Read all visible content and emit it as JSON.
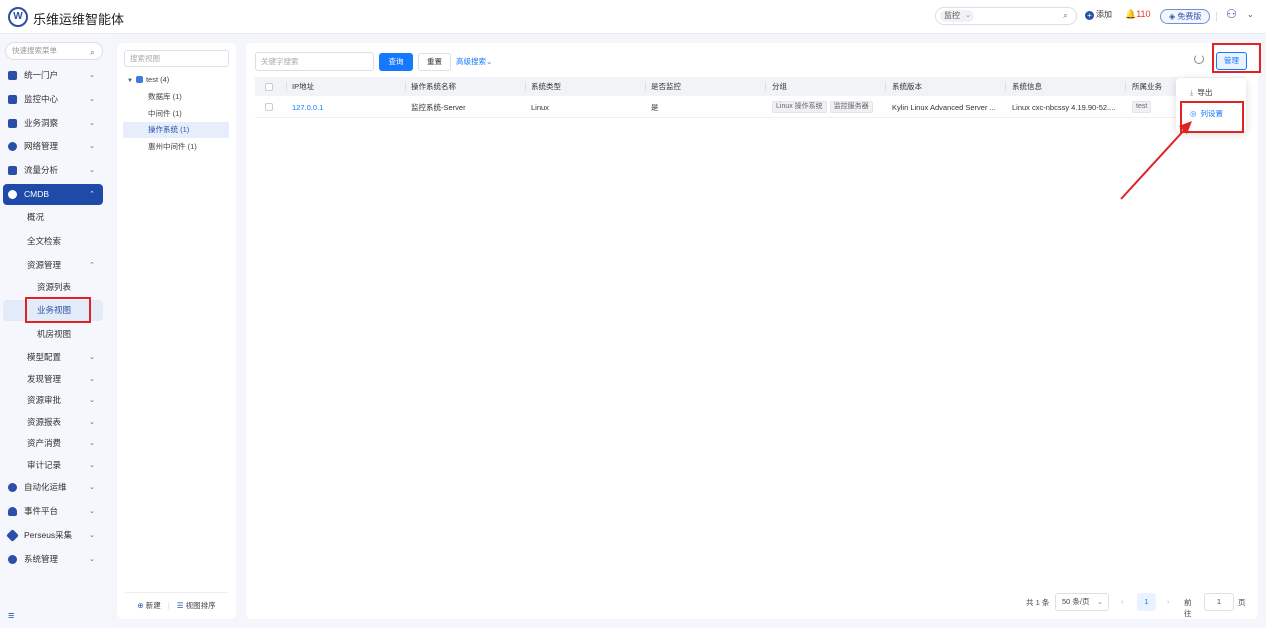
{
  "app": {
    "logo": "W",
    "title": "乐维运维智能体"
  },
  "topbar": {
    "search_scope": "监控",
    "add_label": "添加",
    "alarm_count": "110",
    "version_badge": "免费版"
  },
  "sidebar": {
    "search_placeholder": "快速搜索菜单",
    "items": [
      {
        "label": "统一门户"
      },
      {
        "label": "监控中心"
      },
      {
        "label": "业务洞察"
      },
      {
        "label": "网络管理"
      },
      {
        "label": "流量分析"
      },
      {
        "label": "CMDB"
      }
    ],
    "cmdb_children": [
      {
        "label": "概况"
      },
      {
        "label": "全文检索"
      },
      {
        "label": "资源管理"
      },
      {
        "label": "资源列表"
      },
      {
        "label": "业务视图"
      },
      {
        "label": "机房视图"
      },
      {
        "label": "模型配置"
      },
      {
        "label": "发现管理"
      },
      {
        "label": "资源审批"
      },
      {
        "label": "资源报表"
      },
      {
        "label": "资产消费"
      },
      {
        "label": "审计记录"
      }
    ],
    "items_after": [
      {
        "label": "自动化运维"
      },
      {
        "label": "事件平台"
      },
      {
        "label": "Perseus采集"
      },
      {
        "label": "系统管理"
      }
    ]
  },
  "tree": {
    "search_placeholder": "搜索视图",
    "root": {
      "label": "test",
      "count": "(4)"
    },
    "children": [
      {
        "label": "数据库",
        "count": "(1)"
      },
      {
        "label": "中间件",
        "count": "(1)"
      },
      {
        "label": "操作系统",
        "count": "(1)"
      },
      {
        "label": "惠州中间件",
        "count": "(1)"
      }
    ],
    "new_label": "新建",
    "sort_label": "视图排序"
  },
  "main": {
    "keyword_placeholder": "关键字搜索",
    "query_label": "查询",
    "reset_label": "重置",
    "advanced_label": "高级搜索",
    "manage_label": "管理",
    "columns": [
      "IP地址",
      "操作系统名称",
      "系统类型",
      "是否监控",
      "分组",
      "系统版本",
      "系统信息",
      "所属业务"
    ],
    "rows": [
      {
        "ip": "127.0.0.1",
        "name": "监控系统-Server",
        "type": "Linux",
        "monitored": "是",
        "groups": [
          "Linux 操作系统",
          "监控服务器"
        ],
        "version": "Kylin Linux Advanced Server ...",
        "info": "Linux cxc-nbcssy 4.19.90-52....",
        "business": "test"
      }
    ],
    "dropdown": {
      "export_label": "导出",
      "column_settings_label": "列设置"
    },
    "pagination": {
      "total": "共 1 条",
      "page_size": "50 条/页",
      "current": "1",
      "goto_label": "前往",
      "goto_value": "1",
      "page_unit": "页"
    }
  }
}
